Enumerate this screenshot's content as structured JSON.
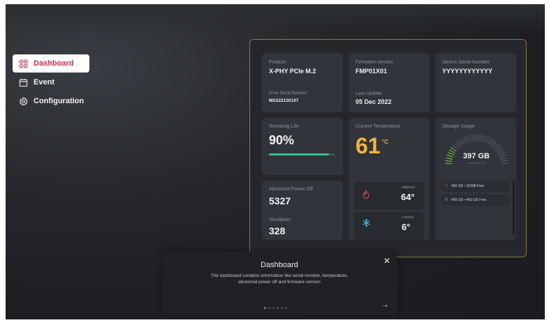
{
  "colors": {
    "accent": "#c0304a",
    "progress": "#3bc08f",
    "temperature": "#f4b43c",
    "panel_border": "#8a7a3a"
  },
  "sidebar": {
    "items": [
      {
        "label": "Dashboard",
        "icon": "dashboard-icon",
        "active": true
      },
      {
        "label": "Event",
        "icon": "calendar-icon",
        "active": false
      },
      {
        "label": "Configuration",
        "icon": "gear-icon",
        "active": false
      }
    ]
  },
  "dashboard": {
    "product": {
      "label": "Product",
      "value": "X-PHY PCIe M.2"
    },
    "drive_serial": {
      "label": "Drive Serial Number:",
      "value": "MS222120147"
    },
    "firmware": {
      "label": "Firmware version",
      "value": "FMP01X01"
    },
    "last_update": {
      "label": "Last Update",
      "value": "05 Dec 2022"
    },
    "device_serial": {
      "label": "Device Serial Number",
      "value": "YYYYYYYYYYYY"
    },
    "remaining_life": {
      "label": "Remainig Life",
      "value": "90%",
      "fraction": 0.9
    },
    "current_temp": {
      "label": "Current Temperature",
      "value": "61",
      "unit": "°C"
    },
    "highest": {
      "label": "Highest",
      "value": "64°"
    },
    "lowest": {
      "label": "Lowest",
      "value": "6°"
    },
    "abnormal_power_off": {
      "label": "Abnormal Power Off",
      "value": "5327"
    },
    "shutdown": {
      "label": "Shutdown",
      "value": "328"
    },
    "storage": {
      "label": "Storage Usage",
      "value": "397 GB",
      "sub": "Used of 466 GB",
      "drives": [
        {
          "letter": "A",
          "text": "466 GB • 33308 Free"
        },
        {
          "letter": "B",
          "text": "466 GB • 466 GB Free"
        }
      ]
    }
  },
  "tour": {
    "title": "Dashboard",
    "description": "The dashboard contains information like serial number, temperature, abnormal power off and firmware version",
    "close": "✕",
    "next": "→",
    "steps": 6,
    "current_step": 1
  }
}
